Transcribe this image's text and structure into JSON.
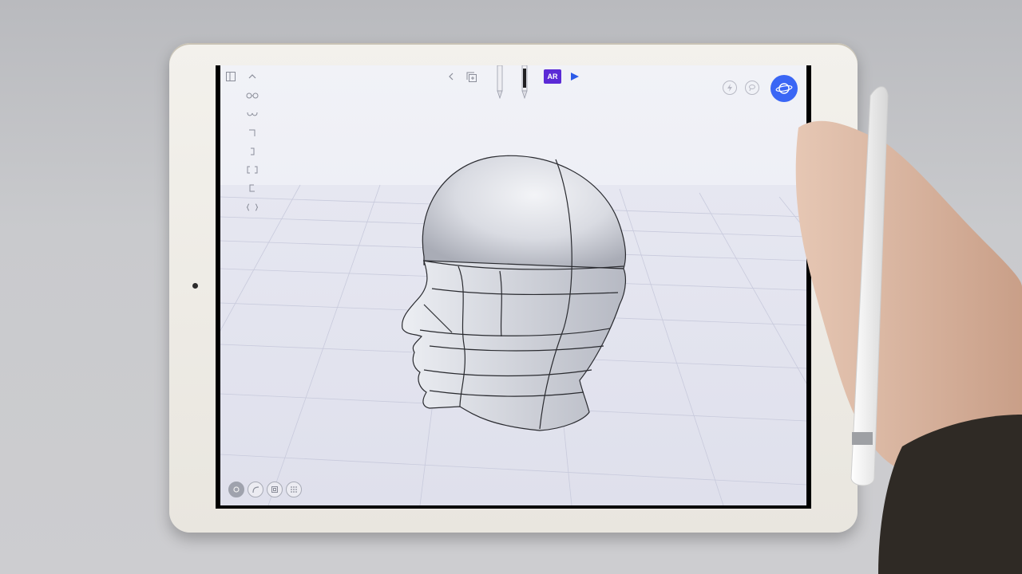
{
  "app": {
    "toolbar": {
      "ar_label": "AR"
    },
    "icons": {
      "layers": "sidebar-panel-icon",
      "collapse": "chevron-up-icon",
      "back": "chevron-left-icon",
      "duplicate": "duplicate-icon",
      "pencil": "pencil-icon",
      "marker": "marker-icon",
      "play": "play-icon",
      "globe": "globe-icon"
    },
    "side_tools": [
      "glasses-tool-icon",
      "loop-tool-icon",
      "corner-tool-icon",
      "bracket-right-tool-icon",
      "bracket-both-tool-icon",
      "bracket-left-tool-icon",
      "curly-tool-icon"
    ],
    "bottom_tools": [
      "settings-tool-icon",
      "curve-tool-icon",
      "frame-tool-icon",
      "grid-tool-icon"
    ],
    "colors": {
      "accent": "#3a66f5",
      "ar_purple": "#5b2ad6",
      "play_blue": "#2b5be8"
    }
  }
}
